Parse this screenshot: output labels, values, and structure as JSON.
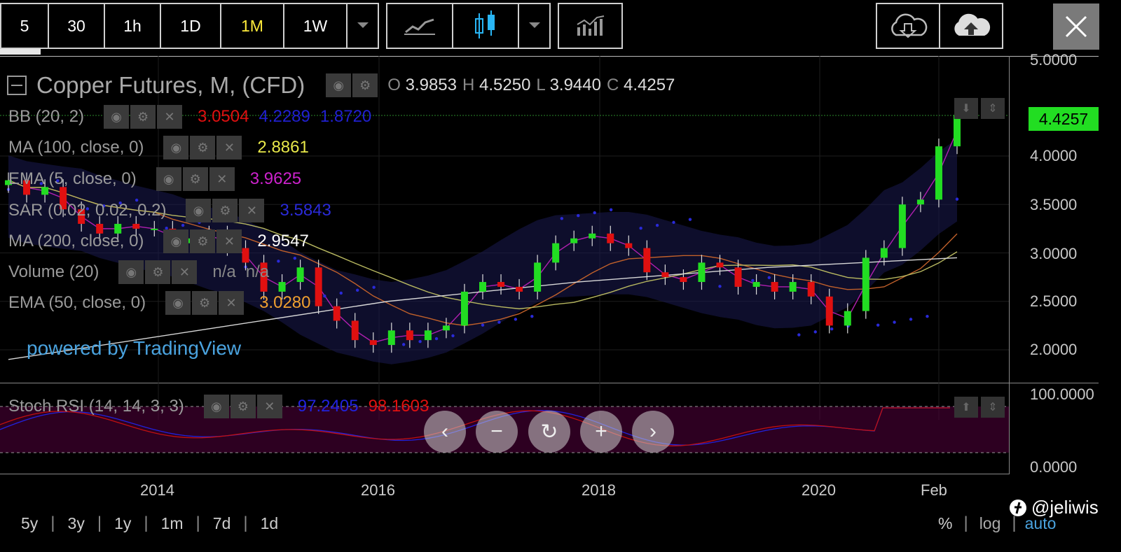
{
  "toolbar": {
    "intervals": [
      "5",
      "30",
      "1h",
      "1D",
      "1M",
      "1W"
    ],
    "active_interval": "1M",
    "chart_styles": [
      "line-chart-icon",
      "candlestick-icon"
    ],
    "indicators_icon": "indicators-icon",
    "cloud_download_icon": "cloud-download-icon",
    "cloud_upload_icon": "cloud-upload-icon",
    "close_icon": "close-icon"
  },
  "header": {
    "title": "Copper Futures, M, (CFD)",
    "ohlc": {
      "o_label": "O",
      "o": "3.9853",
      "h_label": "H",
      "h": "4.5250",
      "l_label": "L",
      "l": "3.9440",
      "c_label": "C",
      "c": "4.4257"
    }
  },
  "legend": [
    {
      "name": "BB (20, 2)",
      "values": [
        "3.0504",
        "4.2289",
        "1.8720"
      ],
      "colors": [
        "#e01010",
        "#2020d0",
        "#2020d0"
      ]
    },
    {
      "name": "MA (100, close, 0)",
      "values": [
        "2.8861"
      ],
      "colors": [
        "#e8e84a"
      ]
    },
    {
      "name": "EMA (5, close, 0)",
      "values": [
        "3.9625"
      ],
      "colors": [
        "#cc22cc"
      ]
    },
    {
      "name": "SAR (0.02, 0.02, 0.2)",
      "values": [
        "3.5843"
      ],
      "colors": [
        "#2a2ad8"
      ]
    },
    {
      "name": "MA (200, close, 0)",
      "values": [
        "2.9547"
      ],
      "colors": [
        "#ffffff"
      ]
    },
    {
      "name": "Volume (20)",
      "values": [
        "n/a",
        "n/a"
      ],
      "colors": [
        "#888888",
        "#888888"
      ]
    },
    {
      "name": "EMA (50, close, 0)",
      "values": [
        "3.0280"
      ],
      "colors": [
        "#f0a030"
      ]
    }
  ],
  "powered_by": "powered by TradingView",
  "price_axis": [
    "5.0000",
    "4.0000",
    "3.5000",
    "3.0000",
    "2.5000",
    "2.0000"
  ],
  "last_price": "4.4257",
  "oscillator": {
    "name": "Stoch RSI (14, 14, 3, 3)",
    "values": [
      "97.2405",
      "98.1603"
    ],
    "colors": [
      "#2222dd",
      "#e01010"
    ],
    "axis": [
      "100.0000",
      "0.0000"
    ]
  },
  "time_axis": [
    "2014",
    "2016",
    "2018",
    "2020",
    "Feb"
  ],
  "ranges": [
    "5y",
    "3y",
    "1y",
    "1m",
    "7d",
    "1d"
  ],
  "scale_options": [
    "%",
    "log",
    "auto"
  ],
  "watermark": "@jeliwis",
  "chart_data": {
    "type": "candlestick",
    "title": "Copper Futures, M, (CFD)",
    "interval": "M",
    "ylim": [
      1.8,
      5.0
    ],
    "y_ticks": [
      2.0,
      2.5,
      3.0,
      3.5,
      4.0,
      5.0
    ],
    "x_ticks": [
      "2014",
      "2016",
      "2018",
      "2020",
      "Feb"
    ],
    "series": [
      {
        "name": "price",
        "x": [
          "2012-09",
          "2012-11",
          "2013-01",
          "2013-03",
          "2013-05",
          "2013-07",
          "2013-09",
          "2013-11",
          "2014-01",
          "2014-03",
          "2014-05",
          "2014-07",
          "2014-09",
          "2014-11",
          "2015-01",
          "2015-03",
          "2015-05",
          "2015-07",
          "2015-09",
          "2015-11",
          "2016-01",
          "2016-03",
          "2016-05",
          "2016-07",
          "2016-09",
          "2016-11",
          "2017-01",
          "2017-03",
          "2017-05",
          "2017-07",
          "2017-09",
          "2017-11",
          "2018-01",
          "2018-03",
          "2018-05",
          "2018-07",
          "2018-09",
          "2018-11",
          "2019-01",
          "2019-03",
          "2019-05",
          "2019-07",
          "2019-09",
          "2019-11",
          "2020-01",
          "2020-03",
          "2020-05",
          "2020-07",
          "2020-09",
          "2020-11",
          "2021-01",
          "2021-02",
          "2021-03"
        ],
        "values": [
          3.75,
          3.6,
          3.68,
          3.45,
          3.3,
          3.2,
          3.3,
          3.25,
          3.25,
          3.1,
          3.15,
          3.2,
          3.05,
          2.9,
          2.6,
          2.7,
          2.85,
          2.45,
          2.3,
          2.1,
          2.05,
          2.2,
          2.1,
          2.2,
          2.25,
          2.6,
          2.7,
          2.65,
          2.6,
          2.9,
          3.1,
          3.15,
          3.2,
          3.1,
          3.05,
          2.8,
          2.75,
          2.7,
          2.9,
          2.85,
          2.65,
          2.7,
          2.6,
          2.7,
          2.55,
          2.25,
          2.4,
          2.95,
          3.05,
          3.5,
          3.55,
          4.1,
          4.4257
        ]
      },
      {
        "name": "MA (200, close, 0)",
        "values": [
          1.9,
          2.2,
          2.5,
          2.7,
          2.85,
          2.95
        ]
      },
      {
        "name": "SAR (0.02, 0.02, 0.2)",
        "values": [
          3.7,
          3.5,
          3.3,
          2.9,
          2.6,
          2.1,
          2.3,
          3.4,
          3.3,
          2.7,
          2.2,
          2.3,
          3.6
        ]
      }
    ],
    "oscillator": {
      "name": "Stoch RSI (14, 14, 3, 3)",
      "ylim": [
        0,
        100
      ],
      "k": 97.2405,
      "d": 98.1603
    }
  }
}
